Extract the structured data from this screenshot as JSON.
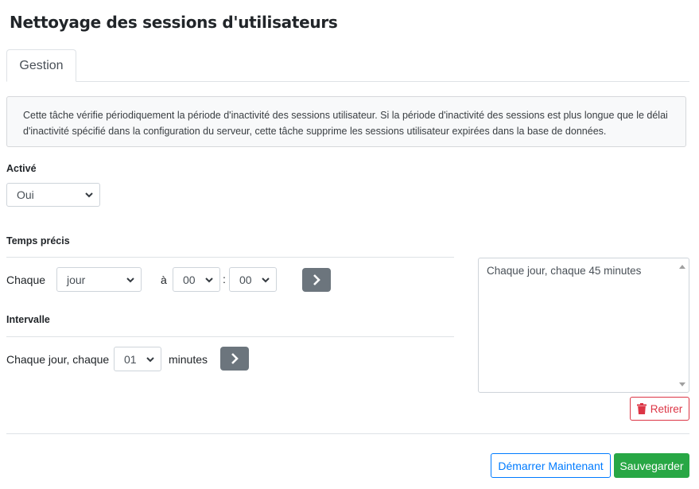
{
  "page": {
    "title": "Nettoyage des sessions d'utilisateurs"
  },
  "tabs": [
    {
      "label": "Gestion",
      "active": true
    }
  ],
  "info": {
    "text": "Cette tâche vérifie périodiquement la période d'inactivité des sessions utilisateur. Si la période d'inactivité des sessions est plus longue que le délai d'inactivité spécifié dans la configuration du serveur, cette tâche supprime les sessions utilisateur expirées dans la base de données."
  },
  "active": {
    "label": "Activé",
    "value": "Oui"
  },
  "precise": {
    "label": "Temps précis",
    "every_label": "Chaque",
    "period_value": "jour",
    "at_label": "à",
    "hour_value": "00",
    "colon": ":",
    "minute_value": "00"
  },
  "interval": {
    "label": "Intervalle",
    "prefix": "Chaque jour, chaque",
    "value": "01",
    "unit": "minutes"
  },
  "schedule_output": {
    "text": "Chaque jour, chaque 45 minutes"
  },
  "buttons": {
    "remove": "Retirer",
    "start_now": "Démarrer Maintenant",
    "save": "Sauvegarder"
  },
  "colors": {
    "primary": "#007bff",
    "success": "#28a745",
    "danger": "#dc3545",
    "secondary": "#6c757d"
  },
  "icons": {
    "chevron": "chevron-down-icon",
    "go": "chevron-right-icon",
    "trash": "trash-icon"
  }
}
